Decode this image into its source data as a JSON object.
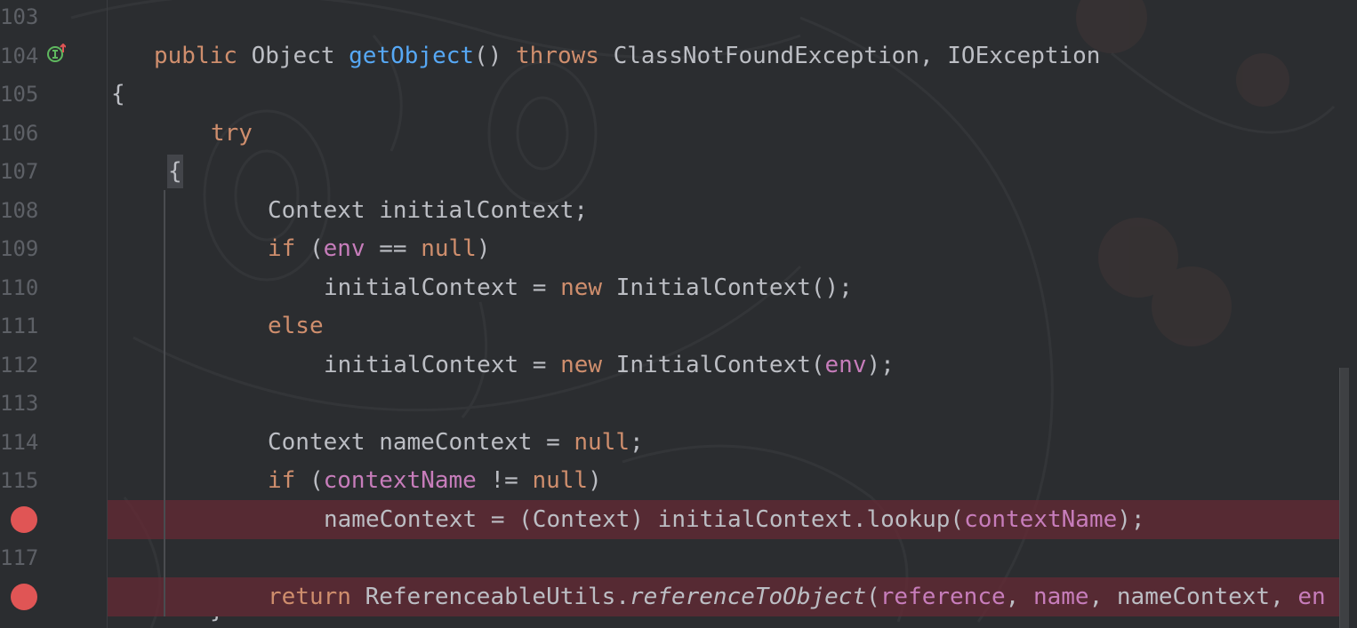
{
  "editor": {
    "line_numbers": [
      "103",
      "104",
      "105",
      "106",
      "107",
      "108",
      "109",
      "110",
      "111",
      "112",
      "113",
      "114",
      "115",
      "117"
    ],
    "gutter_markers": {
      "implements_icon": "override-up-arrow-icon",
      "breakpoint_color": "#e05555"
    },
    "lines": {
      "l104": {
        "kw1": "public",
        "t1": " Object ",
        "fn": "getObject",
        "t2": "() ",
        "kw2": "throws",
        "t3": " ClassNotFoundException, IOException"
      },
      "l105": {
        "t1": "{"
      },
      "l106": {
        "kw1": "try"
      },
      "l107": {
        "t1": "{"
      },
      "l108": {
        "t1": "Context initialContext;"
      },
      "l109": {
        "kw1": "if",
        "t1": " (",
        "f1": "env",
        "t2": " == ",
        "kw2": "null",
        "t3": ")"
      },
      "l110": {
        "t1": "initialContext = ",
        "kw1": "new",
        "t2": " InitialContext();"
      },
      "l111": {
        "kw1": "else"
      },
      "l112": {
        "t1": "initialContext = ",
        "kw1": "new",
        "t2": " InitialContext(",
        "f1": "env",
        "t3": ");"
      },
      "l114": {
        "t1": "Context nameContext = ",
        "kw1": "null",
        "t2": ";"
      },
      "l115": {
        "kw1": "if",
        "t1": " (",
        "f1": "contextName",
        "t2": " != ",
        "kw2": "null",
        "t3": ")"
      },
      "l116": {
        "t1": "nameContext = (Context) initialContext.lookup(",
        "f1": "contextName",
        "t2": ");"
      },
      "l118": {
        "kw1": "return",
        "t1": " ReferenceableUtils.",
        "it1": "referenceToObject",
        "t2": "(",
        "f1": "reference",
        "t3": ", ",
        "f2": "name",
        "t4": ", nameContext, ",
        "f3": "en"
      },
      "l119": {
        "t1": "}"
      }
    },
    "colors": {
      "background": "#2b2d30",
      "keyword": "#cf8e6d",
      "method": "#56a8f5",
      "field": "#c77dbb",
      "text": "#bcbec4",
      "line_number": "#5d6066",
      "breakpoint_line": "#662a34"
    }
  }
}
